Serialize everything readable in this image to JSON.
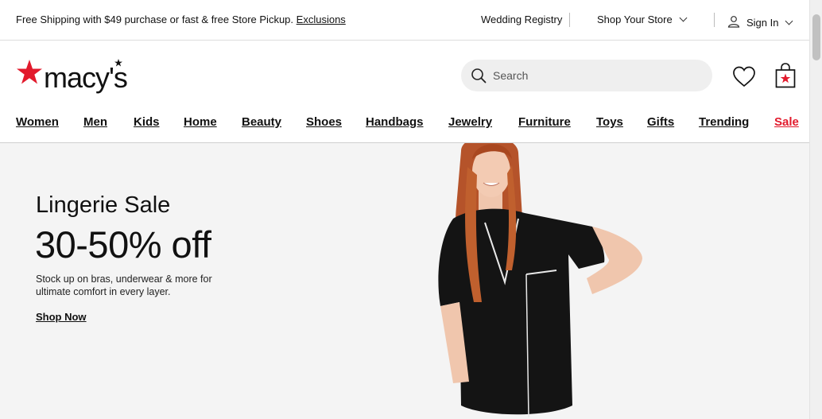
{
  "topbar": {
    "promo_text": "Free Shipping with $49 purchase or fast & free Store Pickup.",
    "promo_link": "Exclusions",
    "wedding_registry": "Wedding Registry",
    "shop_your_store": "Shop Your Store",
    "sign_in": "Sign In"
  },
  "header": {
    "logo_text": "macy's",
    "brand_color": "#e21a2c",
    "search_placeholder": "Search"
  },
  "nav": {
    "items": [
      "Women",
      "Men",
      "Kids",
      "Home",
      "Beauty",
      "Shoes",
      "Handbags",
      "Jewelry",
      "Furniture",
      "Toys",
      "Gifts",
      "Trending",
      "Sale"
    ]
  },
  "hero": {
    "title": "Lingerie Sale",
    "headline": "30-50% off",
    "description": "Stock up on bras, underwear & more for ultimate comfort in every layer.",
    "cta": "Shop Now"
  },
  "icons": {
    "search": "search-icon",
    "wishlist": "heart-icon",
    "bag": "shopping-bag-icon",
    "account": "user-icon"
  }
}
